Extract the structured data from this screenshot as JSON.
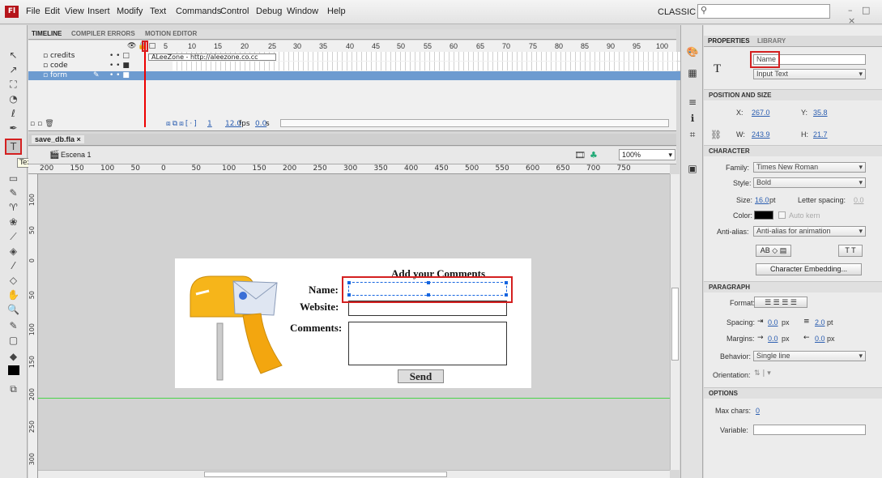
{
  "menubar": {
    "logo": "Fl",
    "items": [
      "File",
      "Edit",
      "View",
      "Insert",
      "Modify",
      "Text",
      "Commands",
      "Control",
      "Debug",
      "Window",
      "Help"
    ],
    "workspace": "CLASSIC ▾",
    "window_controls": "– □ ×"
  },
  "tooltip": "Text Tool (T)",
  "timeline": {
    "tabs": [
      "TIMELINE",
      "COMPILER ERRORS",
      "MOTION EDITOR"
    ],
    "frame_numbers": [
      "5",
      "10",
      "15",
      "20",
      "25",
      "30",
      "35",
      "40",
      "45",
      "50",
      "55",
      "60",
      "65",
      "70",
      "75",
      "80",
      "85",
      "90",
      "95",
      "100"
    ],
    "layers": [
      "credits",
      "code",
      "form"
    ],
    "frame_label": "ALeeZone - http://aleezone.co.cc",
    "footer": {
      "frame": "1",
      "fps": "12.0",
      "fps_unit": "fps",
      "time": "0.0",
      "time_unit": "s"
    }
  },
  "document": {
    "tab": "save_db.fla ×",
    "scene": "Escena 1",
    "zoom": "100%",
    "ruler_h": [
      "200",
      "150",
      "100",
      "50",
      "0",
      "50",
      "100",
      "150",
      "200",
      "250",
      "300",
      "350",
      "400",
      "450",
      "500",
      "550",
      "600",
      "650",
      "700",
      "750"
    ],
    "ruler_v": [
      "100",
      "50",
      "0",
      "50",
      "100",
      "150",
      "200",
      "250",
      "300"
    ]
  },
  "form": {
    "title": "Add your Comments",
    "name_label": "Name:",
    "website_label": "Website:",
    "comments_label": "Comments:",
    "send": "Send"
  },
  "properties": {
    "tabs": [
      "PROPERTIES",
      "LIBRARY"
    ],
    "instance_name": "Name",
    "text_type": "Input Text",
    "position_size": {
      "header": "POSITION AND SIZE",
      "x_label": "X:",
      "x": "267.0",
      "y_label": "Y:",
      "y": "35.8",
      "w_label": "W:",
      "w": "243.9",
      "h_label": "H:",
      "h": "21.7"
    },
    "character": {
      "header": "CHARACTER",
      "family_label": "Family:",
      "family": "Times New Roman",
      "style_label": "Style:",
      "style": "Bold",
      "size_label": "Size:",
      "size": "16.0",
      "size_unit": "pt",
      "letter_spacing_label": "Letter spacing:",
      "letter_spacing": "0.0",
      "color_label": "Color:",
      "color": "#000000",
      "auto_kern": "Auto kern",
      "antialias_label": "Anti-alias:",
      "antialias": "Anti-alias for animation",
      "embed_button": "Character Embedding..."
    },
    "paragraph": {
      "header": "PARAGRAPH",
      "format_label": "Format:",
      "spacing_label": "Spacing:",
      "spacing1": "0.0",
      "spacing1_unit": "px",
      "spacing2": "2.0",
      "spacing2_unit": "pt",
      "margins_label": "Margins:",
      "margin1": "0.0",
      "margin1_unit": "px",
      "margin2": "0.0",
      "margin2_unit": "px",
      "behavior_label": "Behavior:",
      "behavior": "Single line",
      "orientation_label": "Orientation:"
    },
    "options": {
      "header": "OPTIONS",
      "max_chars_label": "Max chars:",
      "max_chars": "0",
      "variable_label": "Variable:"
    }
  },
  "colors": {
    "highlight": "#d42020",
    "selection": "#1565e0",
    "stage_guide": "#4ad44a"
  }
}
